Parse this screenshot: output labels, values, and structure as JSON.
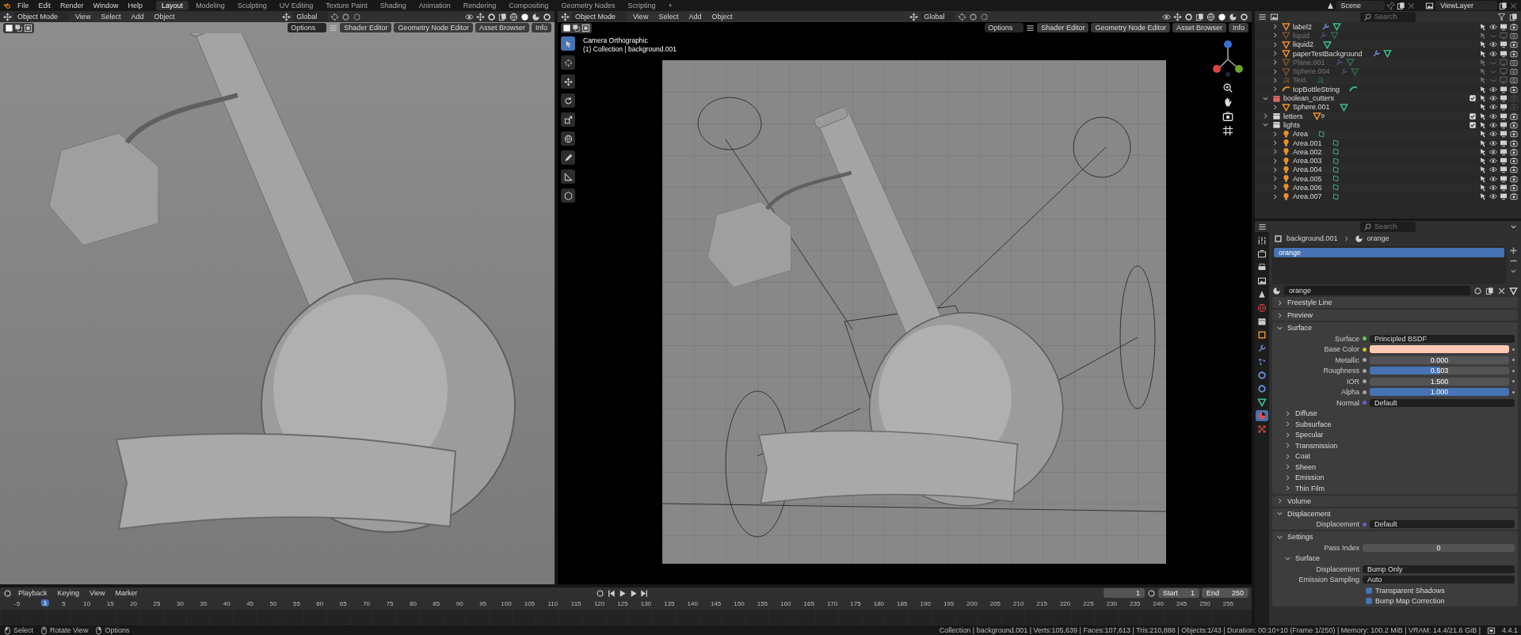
{
  "menu_bar": {
    "menus": [
      "File",
      "Edit",
      "Render",
      "Window",
      "Help"
    ],
    "workspaces": [
      {
        "label": "Layout",
        "selected": true
      },
      {
        "label": "Modeling",
        "selected": false
      },
      {
        "label": "Sculpting",
        "selected": false
      },
      {
        "label": "UV Editing",
        "selected": false
      },
      {
        "label": "Texture Paint",
        "selected": false
      },
      {
        "label": "Shading",
        "selected": false
      },
      {
        "label": "Animation",
        "selected": false
      },
      {
        "label": "Rendering",
        "selected": false
      },
      {
        "label": "Compositing",
        "selected": false
      },
      {
        "label": "Geometry Nodes",
        "selected": false
      },
      {
        "label": "Scripting",
        "selected": false
      }
    ],
    "add_workspace": "+",
    "scene": "Scene",
    "view_layer": "ViewLayer"
  },
  "viewports": [
    {
      "kind": "solid",
      "mode": "Object Mode",
      "menus": [
        "View",
        "Select",
        "Add",
        "Object"
      ],
      "orientation": "Global",
      "options": "Options",
      "editor_buttons": [
        "Shader Editor",
        "Geometry Node Editor",
        "Asset Browser",
        "Info"
      ]
    },
    {
      "kind": "camera",
      "mode": "Object Mode",
      "menus": [
        "View",
        "Select",
        "Add",
        "Object"
      ],
      "orientation": "Global",
      "options": "Options",
      "editor_buttons": [
        "Shader Editor",
        "Geometry Node Editor",
        "Asset Browser",
        "Info"
      ],
      "camera_title": "Camera Orthographic",
      "camera_subtitle": "(1) Collection | background.001"
    }
  ],
  "outliner": {
    "search_placeholder": "Search",
    "items": [
      {
        "name": "label2",
        "kind": "mesh",
        "expanded": false,
        "hidden": false,
        "renderable": true,
        "modifiers": true
      },
      {
        "name": "liquid",
        "kind": "mesh",
        "expanded": false,
        "hidden": true,
        "renderable": true,
        "modifiers": true
      },
      {
        "name": "liquid2",
        "kind": "mesh",
        "expanded": false,
        "hidden": false,
        "renderable": true,
        "modifiers": false
      },
      {
        "name": "paperTestBackground",
        "kind": "mesh",
        "expanded": false,
        "hidden": false,
        "renderable": true,
        "modifiers": true
      },
      {
        "name": "Plane.001",
        "kind": "mesh",
        "expanded": false,
        "hidden": true,
        "renderable": true,
        "modifiers": true
      },
      {
        "name": "Sphere.004",
        "kind": "mesh",
        "expanded": false,
        "hidden": true,
        "renderable": true,
        "modifiers": true
      },
      {
        "name": "Text",
        "kind": "text",
        "expanded": false,
        "hidden": true,
        "renderable": true,
        "modifiers": false
      },
      {
        "name": "topBottleString",
        "kind": "curve",
        "expanded": false,
        "hidden": false,
        "renderable": true,
        "modifiers": false
      },
      {
        "name": "boolean_cutters",
        "kind": "collection",
        "color": "#e06666",
        "checked": true,
        "expanded": true,
        "hidden": false,
        "renderable": false,
        "children": [
          {
            "name": "Sphere.001",
            "kind": "mesh",
            "expanded": false,
            "hidden": false,
            "renderable": false,
            "modifiers": false
          }
        ]
      },
      {
        "name": "letters",
        "kind": "collection",
        "color": "#d8d8d8",
        "checked": true,
        "expanded": false,
        "hidden": false,
        "renderable": true,
        "badge": "9"
      },
      {
        "name": "lights",
        "kind": "collection",
        "color": "#d8d8d8",
        "checked": true,
        "expanded": true,
        "hidden": false,
        "renderable": true,
        "children": [
          {
            "name": "Area",
            "kind": "light",
            "expanded": false,
            "hidden": false,
            "renderable": true,
            "modifiers": false
          },
          {
            "name": "Area.001",
            "kind": "light",
            "expanded": false,
            "hidden": false,
            "renderable": true,
            "modifiers": false
          },
          {
            "name": "Area.002",
            "kind": "light",
            "expanded": false,
            "hidden": false,
            "renderable": true,
            "modifiers": false
          },
          {
            "name": "Area.003",
            "kind": "light",
            "expanded": false,
            "hidden": false,
            "renderable": true,
            "modifiers": false
          },
          {
            "name": "Area.004",
            "kind": "light",
            "expanded": false,
            "hidden": false,
            "renderable": true,
            "modifiers": false
          },
          {
            "name": "Area.005",
            "kind": "light",
            "expanded": false,
            "hidden": false,
            "renderable": true,
            "modifiers": false
          },
          {
            "name": "Area.006",
            "kind": "light",
            "expanded": false,
            "hidden": false,
            "renderable": true,
            "modifiers": false
          },
          {
            "name": "Area.007",
            "kind": "light",
            "expanded": false,
            "hidden": false,
            "renderable": true,
            "modifiers": false
          }
        ]
      }
    ]
  },
  "properties": {
    "search_placeholder": "Search",
    "tabs": [
      {
        "kind": "tool",
        "selected": false
      },
      {
        "kind": "render",
        "selected": false
      },
      {
        "kind": "output",
        "selected": false
      },
      {
        "kind": "view",
        "selected": false
      },
      {
        "kind": "scene",
        "selected": false
      },
      {
        "kind": "world",
        "selected": false
      },
      {
        "kind": "collection",
        "selected": false
      },
      {
        "kind": "object",
        "selected": false
      },
      {
        "kind": "modifier",
        "selected": false
      },
      {
        "kind": "particles",
        "selected": false
      },
      {
        "kind": "physics",
        "selected": false
      },
      {
        "kind": "constraints",
        "selected": false
      },
      {
        "kind": "data",
        "selected": false
      },
      {
        "kind": "material",
        "selected": true
      },
      {
        "kind": "texture",
        "selected": false
      }
    ],
    "breadcrumb": [
      "background.001",
      "orange"
    ],
    "slots": [
      {
        "name": "orange",
        "selected": true
      }
    ],
    "material": "orange",
    "panels": [
      {
        "title": "Freestyle Line",
        "expanded": false
      },
      {
        "title": "Preview",
        "expanded": false
      },
      {
        "title": "Surface",
        "expanded": true,
        "rows": [
          {
            "kind": "socket",
            "socket": {
              "color": "#63c763"
            },
            "label": "Surface",
            "value": "Principled BSDF"
          },
          {
            "kind": "swatch",
            "socket": {
              "color": "#c7c729"
            },
            "label": "Base Color",
            "color": "#ffc8b2"
          },
          {
            "kind": "slider",
            "socket": {
              "color": "#a1a1a1"
            },
            "label": "Metallic",
            "value": "0.000",
            "level": 0
          },
          {
            "kind": "slider",
            "socket": {
              "color": "#a1a1a1"
            },
            "label": "Roughness",
            "value": "0.503",
            "level": 0.503
          },
          {
            "kind": "slider",
            "socket": {
              "color": "#a1a1a1"
            },
            "label": "IOR",
            "value": "1.500",
            "level": 0
          },
          {
            "kind": "slider",
            "socket": {
              "color": "#a1a1a1"
            },
            "label": "Alpha",
            "value": "1.000",
            "level": 1
          },
          {
            "kind": "socket",
            "socket": {
              "color": "#6363c7"
            },
            "label": "Normal",
            "value": "Default"
          }
        ],
        "subpanels": [
          {
            "title": "Diffuse",
            "expanded": false
          },
          {
            "title": "Subsurface",
            "expanded": false
          },
          {
            "title": "Specular",
            "expanded": false
          },
          {
            "title": "Transmission",
            "expanded": false
          },
          {
            "title": "Coat",
            "expanded": false
          },
          {
            "title": "Sheen",
            "expanded": false
          },
          {
            "title": "Emission",
            "expanded": false
          },
          {
            "title": "Thin Film",
            "expanded": false
          }
        ]
      },
      {
        "title": "Volume",
        "expanded": false
      },
      {
        "title": "Displacement",
        "expanded": true,
        "rows": [
          {
            "kind": "socket",
            "socket": {
              "color": "#6363c7"
            },
            "label": "Displacement",
            "value": "Default"
          }
        ]
      },
      {
        "title": "Settings",
        "expanded": true,
        "rows": [
          {
            "kind": "number",
            "label": "Pass Index",
            "value": "0"
          }
        ],
        "subpanels": [
          {
            "title": "Surface",
            "expanded": true,
            "rows": [
              {
                "kind": "dropdown",
                "label": "Displacement",
                "value": "Bump Only"
              },
              {
                "kind": "dropdown",
                "label": "Emission Sampling",
                "value": "Auto"
              },
              {
                "kind": "checkbox",
                "label": "Transparent Shadows",
                "checked": true
              },
              {
                "kind": "checkbox",
                "label": "Bump Map Correction",
                "checked": true
              }
            ]
          }
        ]
      }
    ]
  },
  "timeline": {
    "menus": [
      "Playback",
      "Keying",
      "View",
      "Marker"
    ],
    "current_frame": "1",
    "start_label": "Start",
    "start": "1",
    "end_label": "End",
    "end": "250",
    "playhead": "1",
    "ruler_ticks": [
      "-5",
      "5",
      "10",
      "15",
      "20",
      "25",
      "30",
      "35",
      "40",
      "45",
      "50",
      "55",
      "60",
      "65",
      "70",
      "75",
      "80",
      "85",
      "90",
      "95",
      "100",
      "105",
      "110",
      "115",
      "120",
      "125",
      "130",
      "135",
      "140",
      "145",
      "150",
      "155",
      "160",
      "165",
      "170",
      "175",
      "180",
      "185",
      "190",
      "195",
      "200",
      "205",
      "210",
      "215",
      "220",
      "225",
      "230",
      "235",
      "240",
      "245",
      "250",
      "255"
    ]
  },
  "status_bar": {
    "hints": [
      {
        "kind": "left",
        "label": "Select"
      },
      {
        "kind": "middle",
        "label": "Rotate View"
      },
      {
        "kind": "right",
        "label": "Options"
      }
    ],
    "stats": "Collection | background.001 | Verts:105,639 | Faces:107,613 | Tris:210,888 | Objects:1/43 | Duration: 00:10+10 (Frame 1/250) | Memory: 100.2 MiB | VRAM: 14.4/21.6 GiB |",
    "version": "4.4.1"
  }
}
